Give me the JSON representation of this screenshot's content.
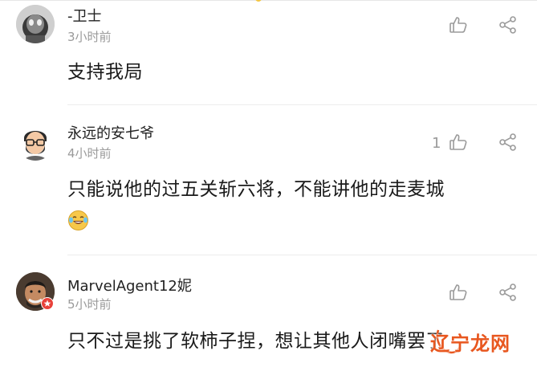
{
  "comments": [
    {
      "username": "-卫士",
      "time": "3小时前",
      "text": "支持我局",
      "likes": "",
      "avatar_icon": "avatar-cartoon-icon",
      "has_emoji": false
    },
    {
      "username": "永远的安七爷",
      "time": "4小时前",
      "text": "只能说他的过五关斩六将，不能讲他的走麦城",
      "likes": "1",
      "avatar_icon": "avatar-bearded-man-glasses-icon",
      "has_emoji": true,
      "emoji_icon": "laughing-tears-emoji-icon"
    },
    {
      "username": "MarvelAgent12妮",
      "time": "5小时前",
      "text": "只不过是挑了软柿子捏，想让其他人闭嘴罢了",
      "likes": "",
      "avatar_icon": "avatar-photo-man-icon",
      "has_emoji": false
    }
  ],
  "watermark": {
    "text": "辽宁龙网"
  },
  "colors": {
    "watermark": "#e8571f",
    "muted": "#9a9a9a",
    "accent_dot": "#f3c542"
  }
}
